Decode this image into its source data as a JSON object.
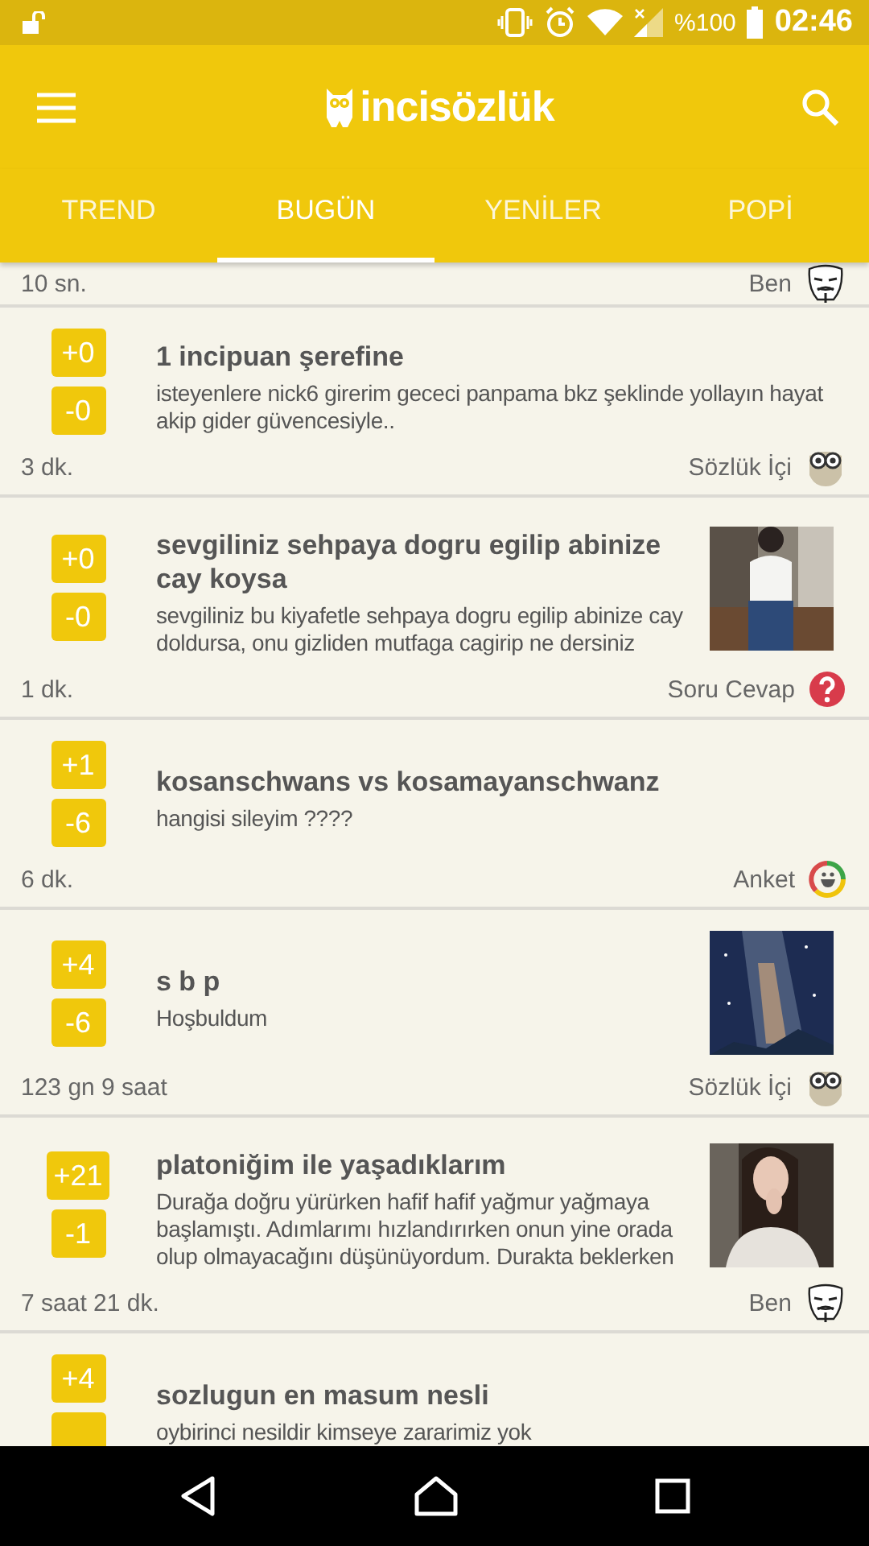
{
  "status_bar": {
    "battery": "%100",
    "time": "02:46"
  },
  "app_bar": {
    "logo": "incisözlük"
  },
  "tabs": [
    {
      "label": "TREND",
      "selected": false
    },
    {
      "label": "BUGÜN",
      "selected": true
    },
    {
      "label": "YENİLER",
      "selected": false
    },
    {
      "label": "POPİ",
      "selected": false
    }
  ],
  "entries": [
    {
      "time": "10 sn.",
      "category": {
        "label": "Ben",
        "kind": "mask"
      }
    },
    {
      "up": "+0",
      "down": "-0",
      "title": "1 incipuan şerefine",
      "body": "isteyenlere nick6 girerim gececi panpama bkz şeklinde yollayın hayat akip gider güvencesiyle..",
      "time": "3 dk.",
      "category": {
        "label": "Sözlük İçi",
        "kind": "owl"
      }
    },
    {
      "up": "+0",
      "down": "-0",
      "title": "sevgiliniz sehpaya dogru egilip abinize cay koysa",
      "body": "sevgiliniz bu kiyafetle sehpaya dogru egilip abinize cay doldursa, onu gizliden mutfaga cagirip ne dersiniz",
      "time": "1 dk.",
      "category": {
        "label": "Soru Cevap",
        "kind": "question"
      }
    },
    {
      "up": "+1",
      "down": "-6",
      "title": "kosanschwans vs kosamayanschwanz",
      "body": "hangisi sileyim ????",
      "time": "6 dk.",
      "category": {
        "label": "Anket",
        "kind": "poll"
      }
    },
    {
      "up": "+4",
      "down": "-6",
      "title": "s b p",
      "body": "Hoşbuldum",
      "time": "123 gn 9 saat",
      "category": {
        "label": "Sözlük İçi",
        "kind": "owl"
      }
    },
    {
      "up": "+21",
      "down": "-1",
      "title": "platoniğim ile yaşadıklarım",
      "body": "Durağa doğru yürürken hafif hafif yağmur yağmaya başlamıştı. Adımlarımı hızlandırırken onun yine orada olup olmayacağını düşünüyordum. Durakta beklerken",
      "time": "7 saat 21 dk.",
      "category": {
        "label": "Ben",
        "kind": "mask"
      }
    },
    {
      "up": "+4",
      "title": "sozlugun en masum nesli",
      "body": "oybirinci nesildir kimseye zararimiz yok"
    }
  ]
}
